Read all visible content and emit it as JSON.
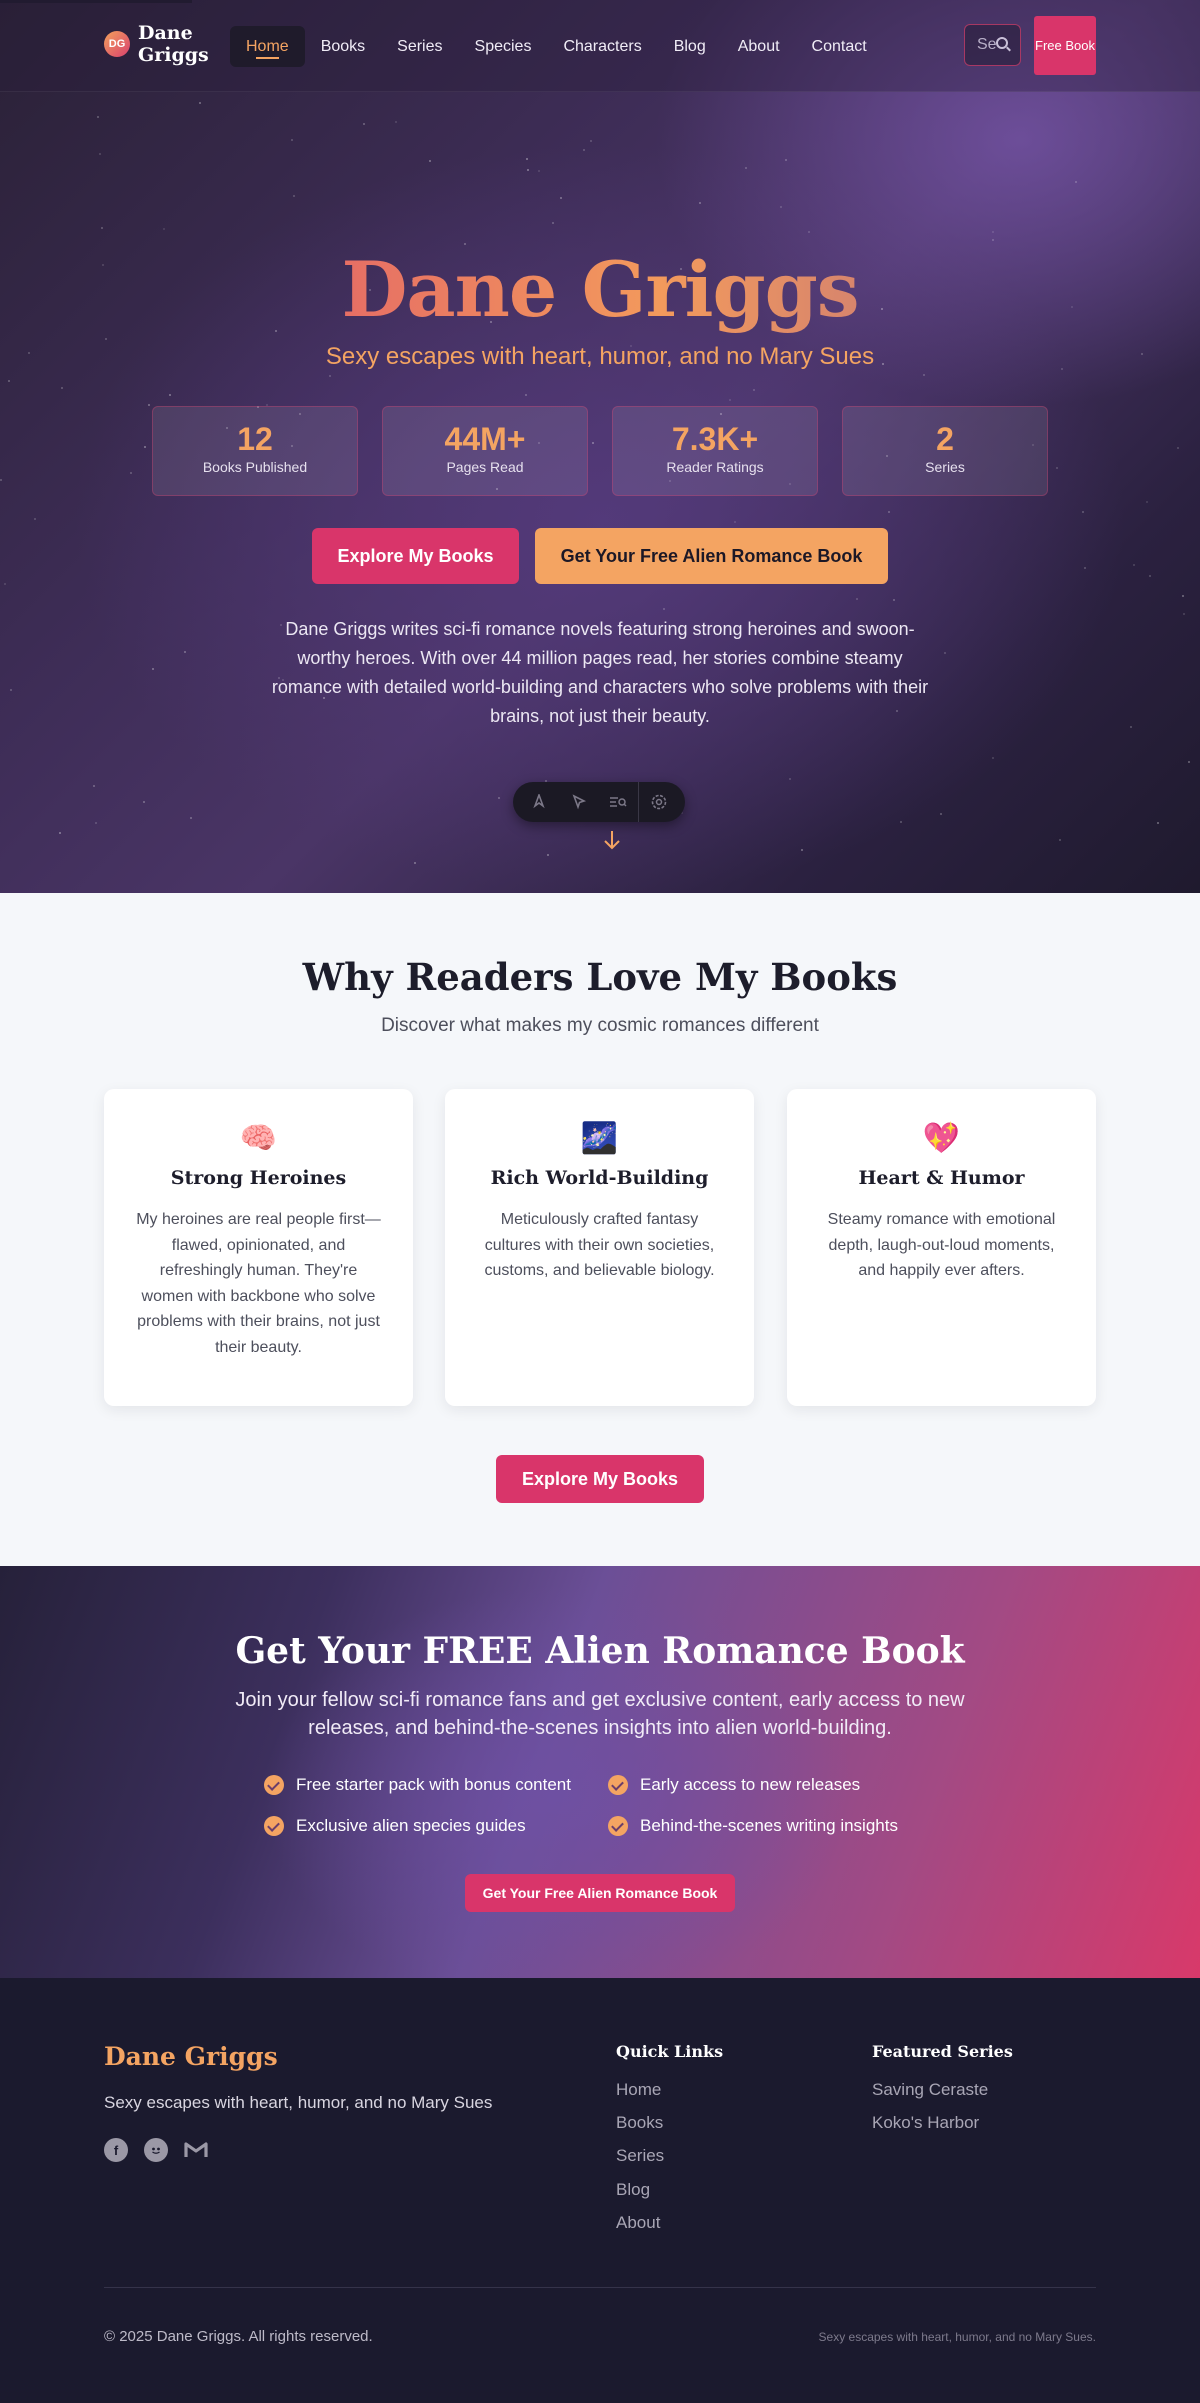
{
  "brand": {
    "initials": "DG",
    "name": "Dane Griggs"
  },
  "nav": {
    "items": [
      "Home",
      "Books",
      "Series",
      "Species",
      "Characters",
      "Blog",
      "About",
      "Contact"
    ],
    "active": "Home",
    "search_placeholder": "Se",
    "free_book_label": "Free Book"
  },
  "hero": {
    "title": "Dane Griggs",
    "tagline": "Sexy escapes with heart, humor, and no Mary Sues",
    "stats": [
      {
        "value": "12",
        "label": "Books Published"
      },
      {
        "value": "44M+",
        "label": "Pages Read"
      },
      {
        "value": "7.3K+",
        "label": "Reader Ratings"
      },
      {
        "value": "2",
        "label": "Series"
      }
    ],
    "primary_button": "Explore My Books",
    "secondary_button": "Get Your Free Alien Romance Book",
    "description": "Dane Griggs writes sci-fi romance novels featuring strong heroines and swoon-worthy heroes. With over 44 million pages read, her stories combine steamy romance with detailed world-building and characters who solve problems with their brains, not just their beauty."
  },
  "toolbar": {
    "icons": [
      "rocket-icon",
      "pointer-icon",
      "search-list-icon",
      "settings-icon"
    ]
  },
  "why": {
    "title": "Why Readers Love My Books",
    "subtitle": "Discover what makes my cosmic romances different",
    "cards": [
      {
        "icon": "🧠",
        "icon_name": "brain-icon",
        "title": "Strong Heroines",
        "text": "My heroines are real people first—flawed, opinionated, and refreshingly human. They're women with backbone who solve problems with their brains, not just their beauty."
      },
      {
        "icon": "🌌",
        "icon_name": "galaxy-icon",
        "title": "Rich World-Building",
        "text": "Meticulously crafted fantasy cultures with their own societies, customs, and believable biology."
      },
      {
        "icon": "💖",
        "icon_name": "sparkling-heart-icon",
        "title": "Heart & Humor",
        "text": "Steamy romance with emotional depth, laugh-out-loud moments, and happily ever afters."
      }
    ],
    "button": "Explore My Books"
  },
  "cta": {
    "title": "Get Your FREE Alien Romance Book",
    "subtitle": "Join your fellow sci-fi romance fans and get exclusive content, early access to new releases, and behind-the-scenes insights into alien world-building.",
    "features": [
      "Free starter pack with bonus content",
      "Early access to new releases",
      "Exclusive alien species guides",
      "Behind-the-scenes writing insights"
    ],
    "button": "Get Your Free Alien Romance Book"
  },
  "footer": {
    "brand": "Dane Griggs",
    "tagline": "Sexy escapes with heart, humor, and no Mary Sues",
    "social": [
      "facebook-icon",
      "reddit-icon",
      "gmail-icon"
    ],
    "quick_links_title": "Quick Links",
    "quick_links": [
      "Home",
      "Books",
      "Series",
      "Blog",
      "About"
    ],
    "featured_title": "Featured Series",
    "featured": [
      "Saving Ceraste",
      "Koko's Harbor"
    ],
    "copyright": "© 2025 Dane Griggs. All rights reserved.",
    "bottom_tagline": "Sexy escapes with heart, humor, and no Mary Sues."
  },
  "colors": {
    "accent_pink": "#d9356a",
    "accent_orange": "#f4a462",
    "dark": "#1b1a2e"
  }
}
